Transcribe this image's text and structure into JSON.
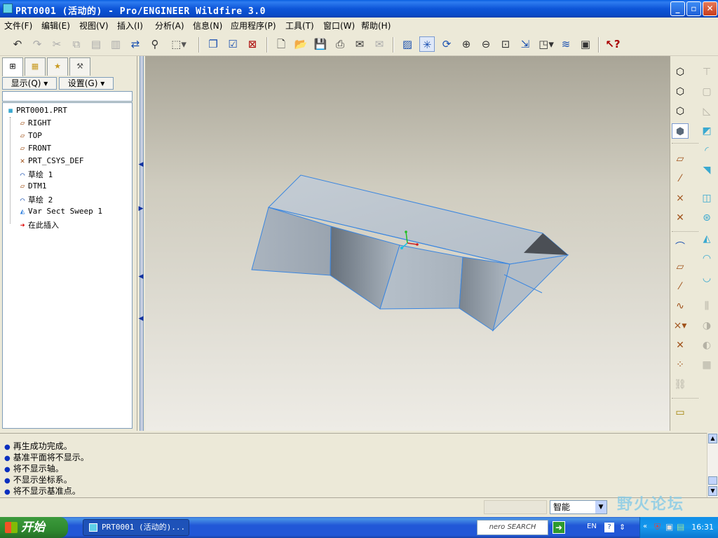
{
  "window": {
    "title": "PRT0001 (活动的) - Pro/ENGINEER Wildfire 3.0",
    "min_label": "_",
    "max_label": "▫",
    "close_label": "✕"
  },
  "menu": [
    "文件(F)",
    "编辑(E)",
    "视图(V)",
    "插入(I)",
    "分析(A)",
    "信息(N)",
    "应用程序(P)",
    "工具(T)",
    "窗口(W)",
    "帮助(H)"
  ],
  "toolbar": {
    "icons": [
      "undo-icon",
      "redo-icon",
      "cut-icon",
      "copy-icon",
      "paste-icon",
      "paste-special-icon",
      "regenerate-icon",
      "find-icon",
      "select-box-icon",
      "new-window-icon",
      "activate-window-icon",
      "close-window-icon",
      "new-file-icon",
      "open-icon",
      "save-icon",
      "print-icon",
      "email-icon",
      "email-link-icon",
      "repaint-icon",
      "spin-center-icon",
      "orient-mode-icon",
      "zoom-in-icon",
      "zoom-out-icon",
      "refit-icon",
      "reorient-icon",
      "saved-views-icon",
      "layers-icon",
      "view-manager-icon",
      "context-help-icon"
    ]
  },
  "left_panel": {
    "tabs": [
      "model-tree-tab",
      "folder-browser-tab",
      "favorites-tab",
      "connections-tab"
    ],
    "show_button": "显示(Q) ▾",
    "settings_button": "设置(G) ▾",
    "tree": [
      {
        "label": "PRT0001.PRT",
        "icon": "part-icon",
        "level": 0
      },
      {
        "label": "RIGHT",
        "icon": "datum-plane-icon",
        "level": 1
      },
      {
        "label": "TOP",
        "icon": "datum-plane-icon",
        "level": 1
      },
      {
        "label": "FRONT",
        "icon": "datum-plane-icon",
        "level": 1
      },
      {
        "label": "PRT_CSYS_DEF",
        "icon": "csys-icon",
        "level": 1
      },
      {
        "label": "草绘 1",
        "icon": "sketch-icon",
        "level": 1
      },
      {
        "label": "DTM1",
        "icon": "datum-plane-icon",
        "level": 1
      },
      {
        "label": "草绘 2",
        "icon": "sketch-icon",
        "level": 1
      },
      {
        "label": "Var Sect Sweep 1",
        "icon": "sweep-icon",
        "level": 1
      },
      {
        "label": "在此插入",
        "icon": "insert-arrow-icon",
        "level": 1
      }
    ]
  },
  "messages": [
    "再生成功完成。",
    "基准平面将不显示。",
    "将不显示轴。",
    "不显示坐标系。",
    "将不显示基准点。"
  ],
  "status": {
    "filter_value": "智能"
  },
  "taskbar": {
    "start_label": "开始",
    "task_item": "PRT0001 (活动的)...",
    "nero_label": "nero SEARCH",
    "ime": "EN",
    "clock": "16:31"
  },
  "watermark": "野火论坛",
  "colors": {
    "model_edge": "#3a86e0",
    "model_face_light": "#b9c3cc",
    "model_face_dark": "#6d7782",
    "accent_blue": "#0a2fbf"
  }
}
